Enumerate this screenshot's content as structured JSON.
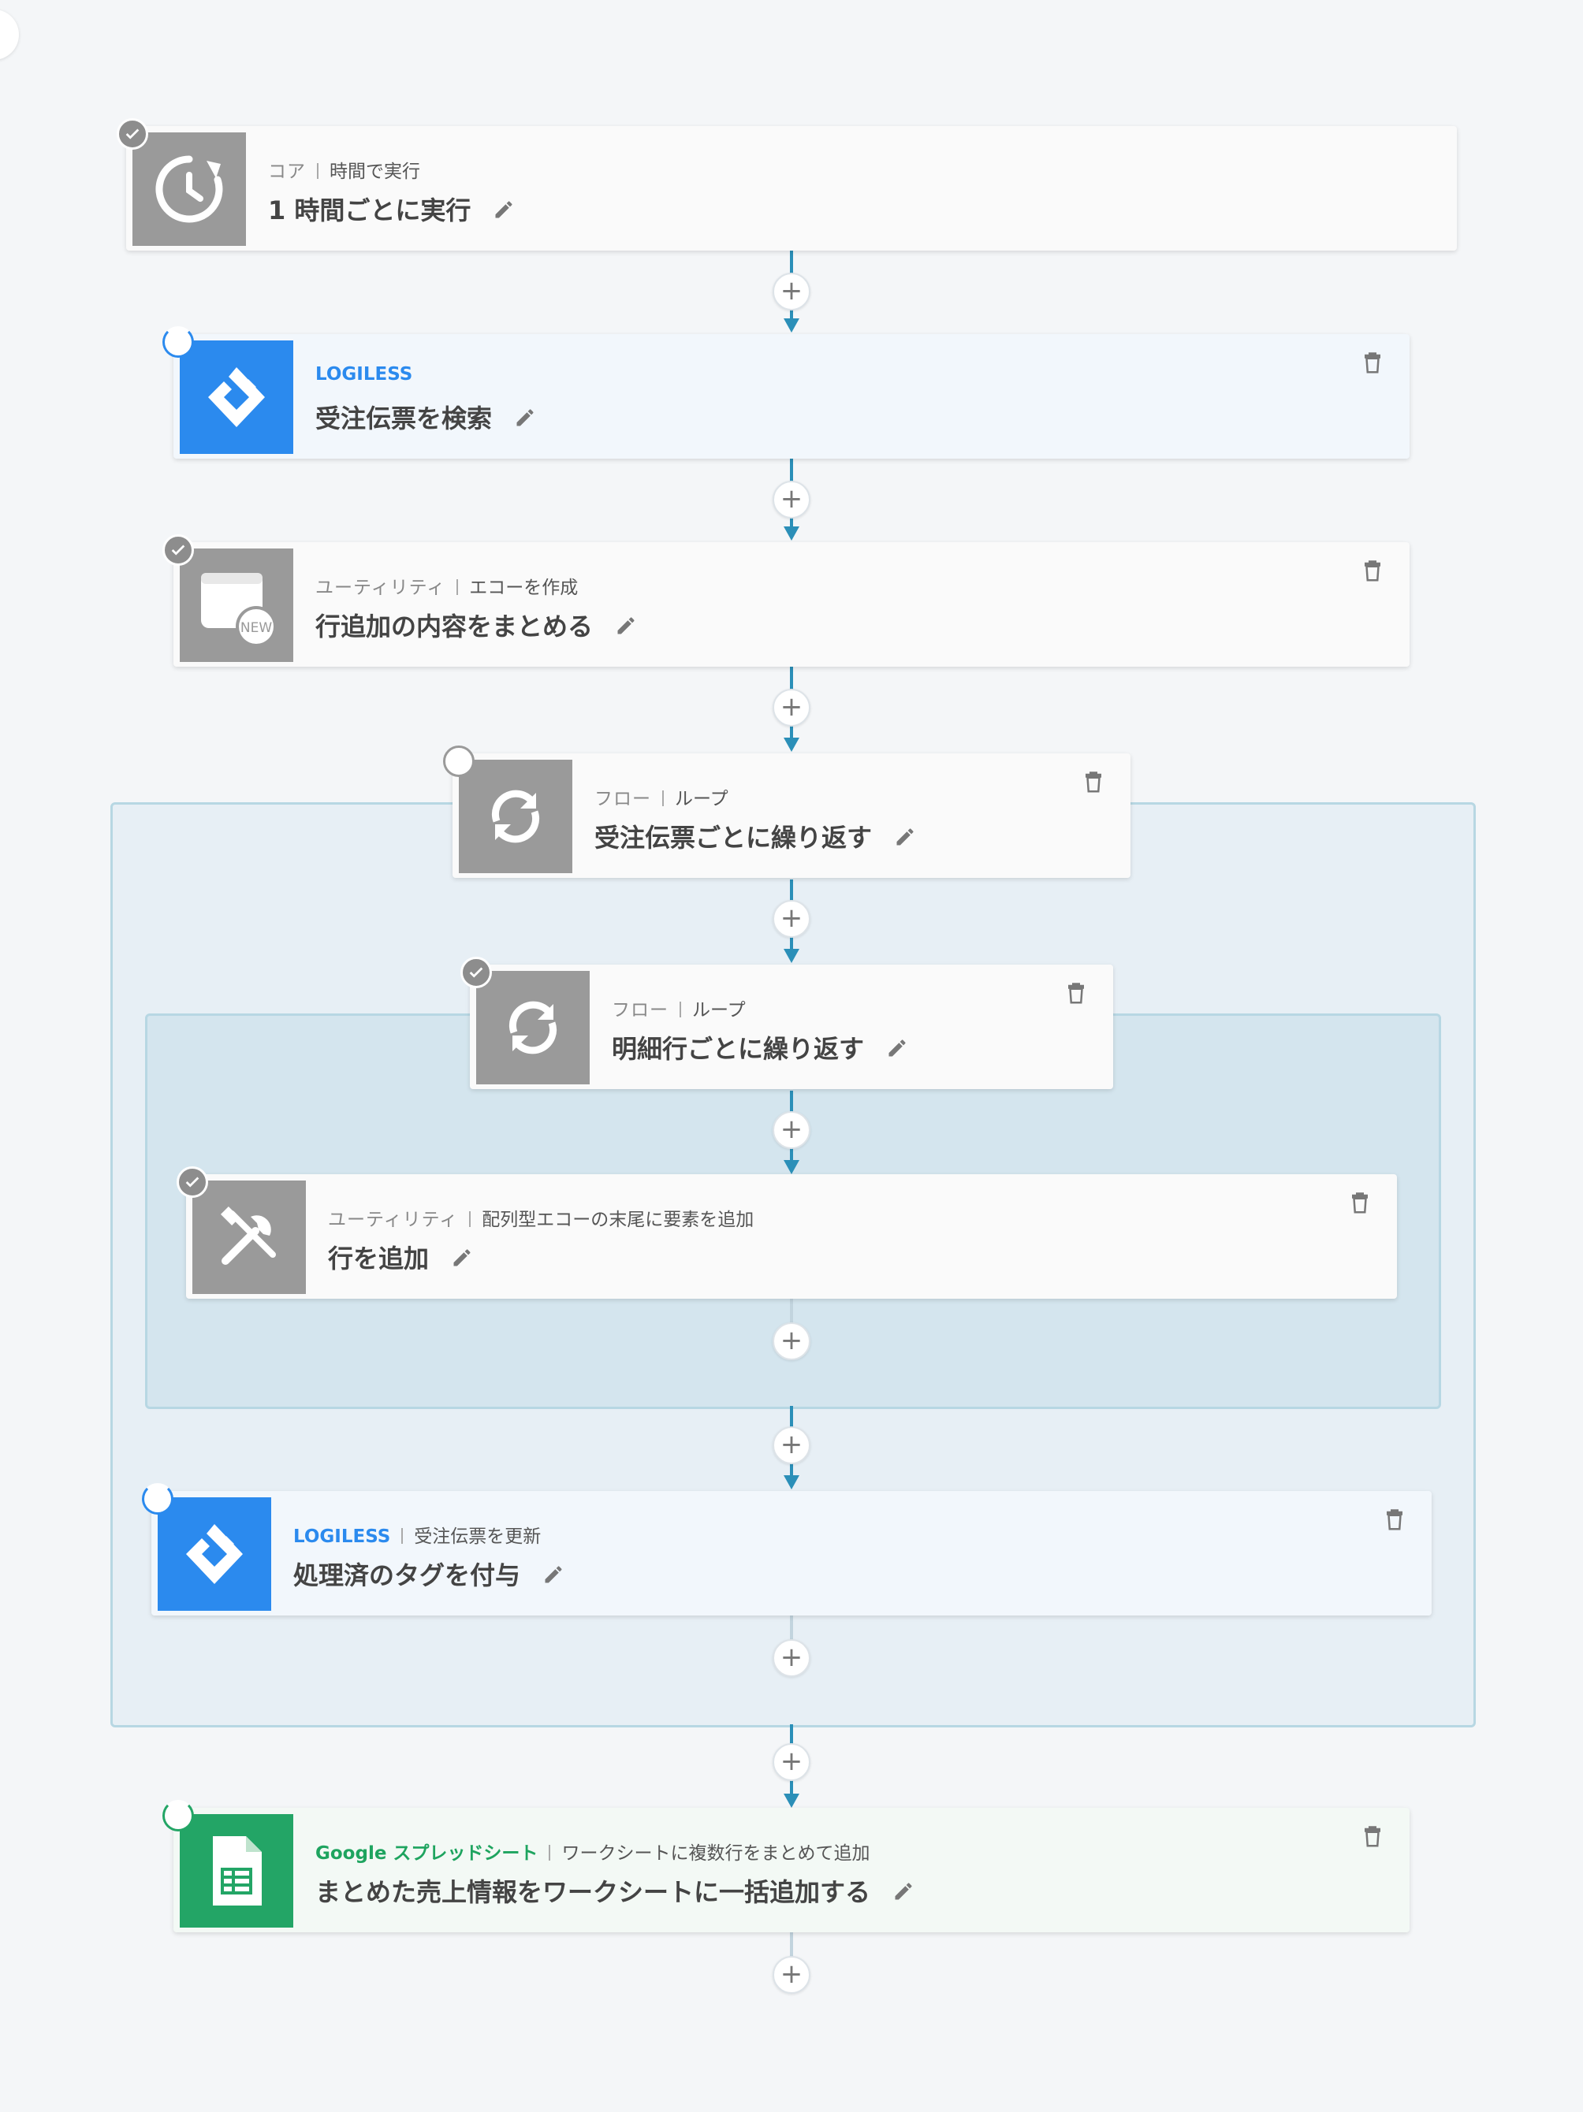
{
  "steps": [
    {
      "category": "コア",
      "action": "時間で実行",
      "title": "1 時間ごとに実行"
    },
    {
      "category": "LOGILESS",
      "action": "",
      "title": "受注伝票を検索"
    },
    {
      "category": "ユーティリティ",
      "action": "エコーを作成",
      "title": "行追加の内容をまとめる",
      "icon_badge": "NEW"
    },
    {
      "category": "フロー",
      "action": "ループ",
      "title": "受注伝票ごとに繰り返す"
    },
    {
      "category": "フロー",
      "action": "ループ",
      "title": "明細行ごとに繰り返す"
    },
    {
      "category": "ユーティリティ",
      "action": "配列型エコーの末尾に要素を追加",
      "title": "行を追加"
    },
    {
      "category": "LOGILESS",
      "action": "受注伝票を更新",
      "title": "処理済のタグを付与"
    },
    {
      "category": "Google スプレッドシート",
      "action": "ワークシートに複数行をまとめて追加",
      "title": "まとめた売上情報をワークシートに一括追加する"
    }
  ],
  "plus_symbol": "+",
  "colors": {
    "accent": "#2b8fb8",
    "logiless": "#2b8aee",
    "sheets": "#23a566",
    "gray_icon": "#9a9a9a"
  }
}
